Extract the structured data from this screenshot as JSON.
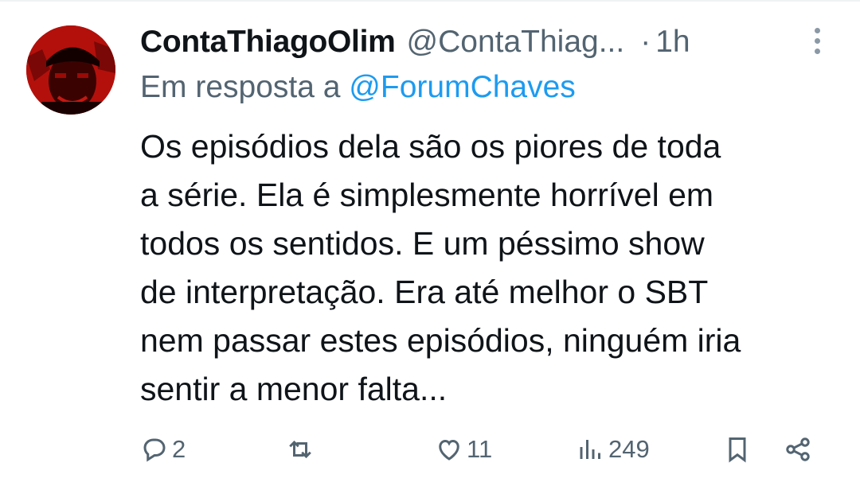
{
  "tweet": {
    "display_name": "ContaThiagoOlim",
    "handle": "@ContaThiag...",
    "separator": "·",
    "time": "1h",
    "reply_prefix": "Em resposta a",
    "reply_to": "@ForumChaves",
    "body": "Os episódios dela são os piores de toda\na série. Ela é simplesmente horrível em\ntodos os sentidos. E um péssimo show\nde interpretação. Era até melhor o SBT\nnem passar estes episódios, ninguém iria\nsentir a menor falta..."
  },
  "actions": {
    "replies": "2",
    "retweets": "",
    "likes": "11",
    "views": "249"
  },
  "icons": {
    "more": "more-vertical-icon",
    "reply": "reply-icon",
    "retweet": "retweet-icon",
    "like": "heart-icon",
    "views": "views-icon",
    "bookmark": "bookmark-icon",
    "share": "share-icon"
  },
  "colors": {
    "text": "#0f1419",
    "secondary": "#536471",
    "link": "#1d9bf0",
    "avatar_bg": "#b3100c"
  }
}
